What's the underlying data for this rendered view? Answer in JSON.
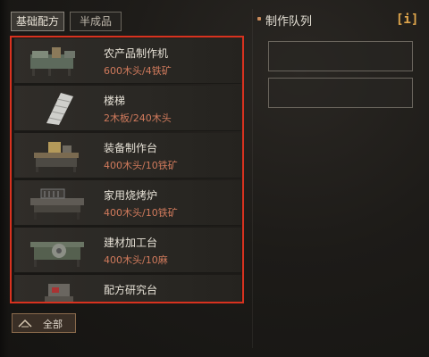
{
  "tabs": [
    {
      "label": "基础配方",
      "active": true
    },
    {
      "label": "半成品",
      "active": false
    }
  ],
  "recipes": [
    {
      "name": "农产品制作机",
      "cost": "600木头/4铁矿",
      "icon": "farm-machine-icon"
    },
    {
      "name": "楼梯",
      "cost": "2木板/240木头",
      "icon": "stairs-icon"
    },
    {
      "name": "装备制作台",
      "cost": "400木头/10铁矿",
      "icon": "equipment-bench-icon"
    },
    {
      "name": "家用烧烤炉",
      "cost": "400木头/10铁矿",
      "icon": "grill-icon"
    },
    {
      "name": "建材加工台",
      "cost": "400木头/10麻",
      "icon": "material-bench-icon"
    },
    {
      "name": "配方研究台",
      "cost": "",
      "icon": "research-bench-icon"
    }
  ],
  "all_button": {
    "label": "全部",
    "icon": "chevron-up-icon"
  },
  "queue": {
    "title": "制作队列",
    "info_label": "[i]"
  },
  "colors": {
    "highlight_border": "#d8321f",
    "cost_text": "#d07a5c",
    "info_accent": "#e0a64c"
  }
}
